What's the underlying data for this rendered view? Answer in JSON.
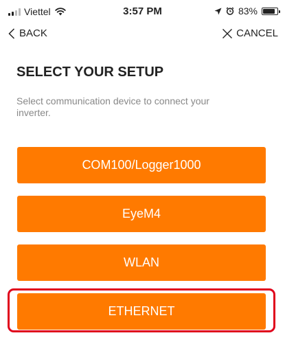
{
  "status_bar": {
    "carrier": "Viettel",
    "time": "3:57 PM",
    "battery": "83%",
    "battery_level": 0.83
  },
  "nav": {
    "back_label": "BACK",
    "cancel_label": "CANCEL"
  },
  "main": {
    "title": "SELECT YOUR SETUP",
    "subtitle": "Select communication device to connect your inverter.",
    "options": [
      {
        "label": "COM100/Logger1000"
      },
      {
        "label": "EyeM4"
      },
      {
        "label": "WLAN"
      },
      {
        "label": "ETHERNET"
      }
    ]
  },
  "colors": {
    "accent": "#ff7a00",
    "highlight": "#e0001b"
  }
}
